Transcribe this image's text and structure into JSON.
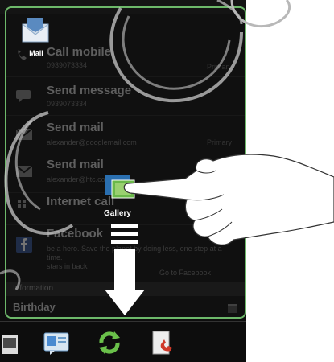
{
  "launcher": {
    "mail_label": "Mail",
    "gallery_label": "Gallery"
  },
  "contact_actions": [
    {
      "title": "Call mobile",
      "sub": "0939073334",
      "tag": "Primary",
      "icon": "phone-icon"
    },
    {
      "title": "Send message",
      "sub": "0939073334",
      "tag": "",
      "icon": "message-icon"
    },
    {
      "title": "Send mail",
      "sub": "alexander@googlemail.com",
      "tag": "Primary",
      "icon": "mail-icon"
    },
    {
      "title": "Send mail",
      "sub": "alexander@htc.com",
      "tag": "",
      "icon": "mail-icon"
    },
    {
      "title": "Internet call",
      "sub": "",
      "tag": "",
      "icon": "internet-call-icon"
    },
    {
      "title": "Facebook",
      "sub": "be a hero. Save the planet by doing less, one step at a time.",
      "tag": "",
      "icon": "facebook-icon"
    }
  ],
  "facebook_extra": "stars in back",
  "facebook_link": "Go to Facebook",
  "section_header": "Information",
  "birthday_label": "Birthday",
  "dock_items": [
    "contact-card-icon",
    "picture-message-icon",
    "sync-icon",
    "phone-call-icon"
  ],
  "colors": {
    "frame_green": "#6db86a",
    "background": "#161616",
    "text_primary": "#cfcfcf",
    "text_secondary": "#7a7a7a"
  }
}
